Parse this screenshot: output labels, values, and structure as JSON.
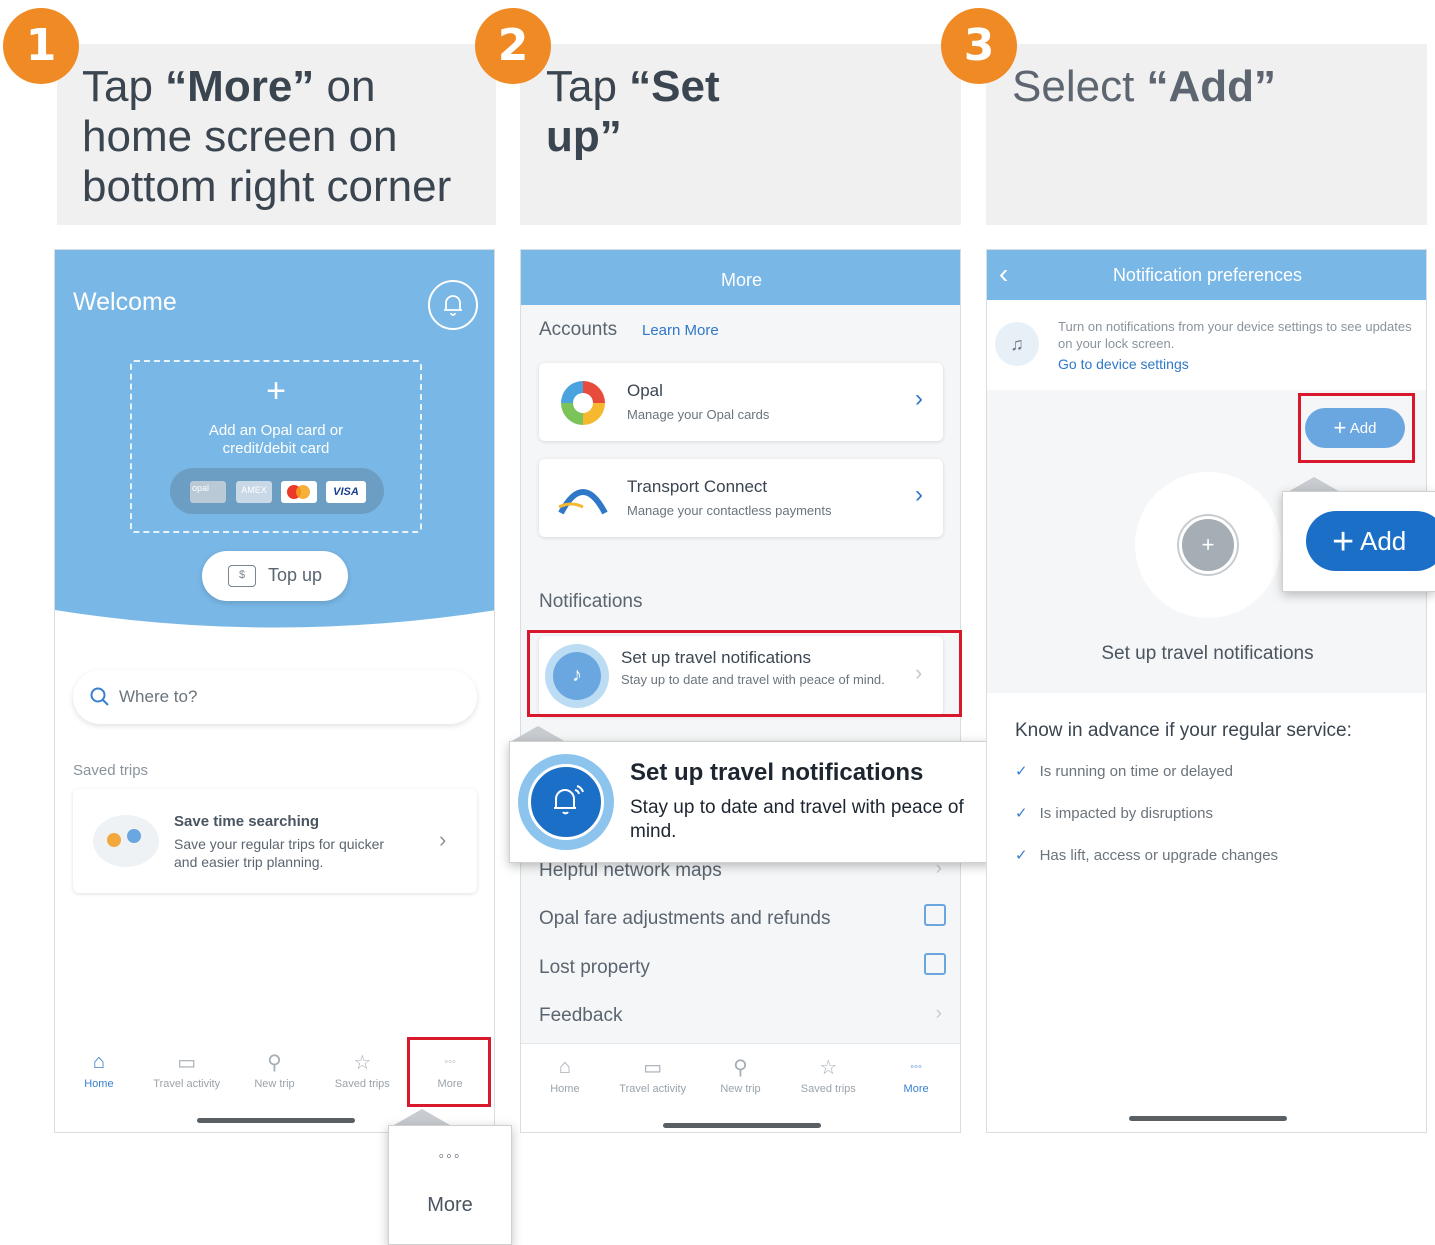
{
  "steps": [
    {
      "number": "1",
      "pre": "Tap ",
      "bold": "“More”",
      "post": " on home screen on bottom right corner"
    },
    {
      "number": "2",
      "pre": "Tap ",
      "bold": "“Set up”",
      "post": ""
    },
    {
      "number": "3",
      "pre": "Select ",
      "bold": "“Add”",
      "post": ""
    }
  ],
  "screen1": {
    "welcome": "Welcome",
    "add_card": "Add an Opal card or credit/debit card",
    "card_logos": [
      "opal",
      "AMEX",
      "",
      "VISA"
    ],
    "top_up": "Top up",
    "search_placeholder": "Where to?",
    "saved_trips_label": "Saved trips",
    "save_title": "Save time searching",
    "save_desc": "Save your regular trips for quicker and easier trip planning.",
    "nav": [
      "Home",
      "Travel activity",
      "New trip",
      "Saved trips",
      "More"
    ],
    "more_callout_icon": "◦◦◦",
    "more_callout_label": "More"
  },
  "screen2": {
    "header": "More",
    "accounts": "Accounts",
    "learn_more": "Learn More",
    "opal_title": "Opal",
    "opal_desc": "Manage your Opal cards",
    "tc_title": "Transport Connect",
    "tc_desc": "Manage your contactless payments",
    "notifications": "Notifications",
    "setup_title": "Set up travel notifications",
    "setup_desc": "Stay up to date and travel with peace of mind.",
    "list": [
      "Helpful network maps",
      "Opal fare adjustments and refunds",
      "Lost property",
      "Feedback"
    ],
    "nav": [
      "Home",
      "Travel activity",
      "New trip",
      "Saved trips",
      "More"
    ]
  },
  "screen3": {
    "header": "Notification preferences",
    "banner_text": "Turn on notifications from your device settings to see updates on your lock screen.",
    "banner_link": "Go to device settings",
    "add_button": "Add",
    "setup_label": "Set up travel notifications",
    "know_title": "Know in advance if your regular service:",
    "checks": [
      "Is running on time or delayed",
      "Is impacted by disruptions",
      "Has lift, access or upgrade changes"
    ],
    "add_callout": "Add"
  },
  "colors": {
    "accent_orange": "#f08a24",
    "header_blue": "#79b7e6",
    "link_blue": "#2f78c8",
    "highlight_red": "#d7192b"
  }
}
